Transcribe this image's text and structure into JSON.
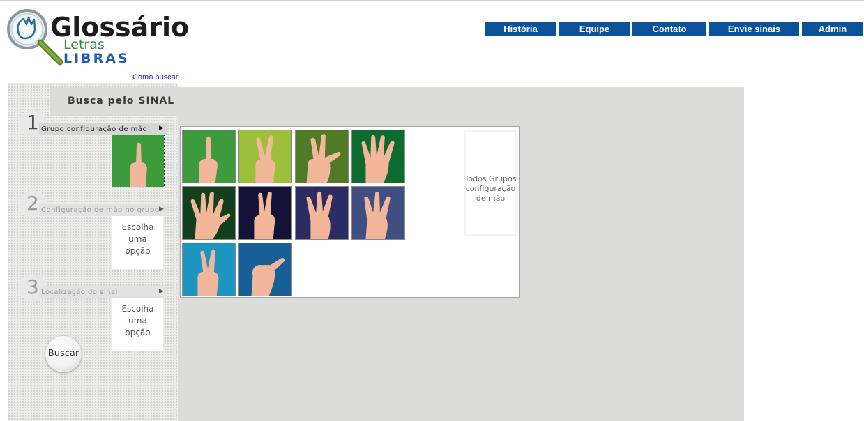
{
  "logo": {
    "title": "Glossário",
    "sub_prefix": "Letras",
    "sub_brand": "LIBRAS"
  },
  "nav": {
    "items": [
      "História",
      "Equipe",
      "Contato",
      "Envie sinais",
      "Admin"
    ],
    "color": "#0b529a"
  },
  "how_to_search": "Como buscar",
  "search_panel": {
    "title": "Busca pelo SINAL",
    "steps": [
      {
        "number": "1",
        "label": "Grupo configuração de mão"
      },
      {
        "number": "2",
        "label": "Configuração de mão no grupo",
        "choice": [
          "Escolha",
          "uma",
          "opção"
        ]
      },
      {
        "number": "3",
        "label": "Localização do sinal",
        "choice": [
          "Escolha",
          "uma",
          "opção"
        ]
      }
    ],
    "search_button": "Buscar"
  },
  "hand_groups": {
    "tiles": [
      {
        "icon": "hand-index-icon",
        "bg": "#3d9a3d"
      },
      {
        "icon": "hand-v-icon",
        "bg": "#9cc03a"
      },
      {
        "icon": "hand-three-icon",
        "bg": "#4f7b27"
      },
      {
        "icon": "hand-four-icon",
        "bg": "#0c6b2e"
      },
      {
        "icon": "hand-open-icon",
        "bg": "#123f1c"
      },
      {
        "icon": "hand-two-icon",
        "bg": "#141236"
      },
      {
        "icon": "hand-three-dark-icon",
        "bg": "#2d2c62"
      },
      {
        "icon": "hand-three-blue-icon",
        "bg": "#3f4f82"
      },
      {
        "icon": "hand-two-cyan-icon",
        "bg": "#1c96c0"
      },
      {
        "icon": "hand-thumb-icon",
        "bg": "#165f97"
      }
    ],
    "all_groups": [
      "Todos Grupos",
      "configuração",
      "de mão"
    ]
  }
}
